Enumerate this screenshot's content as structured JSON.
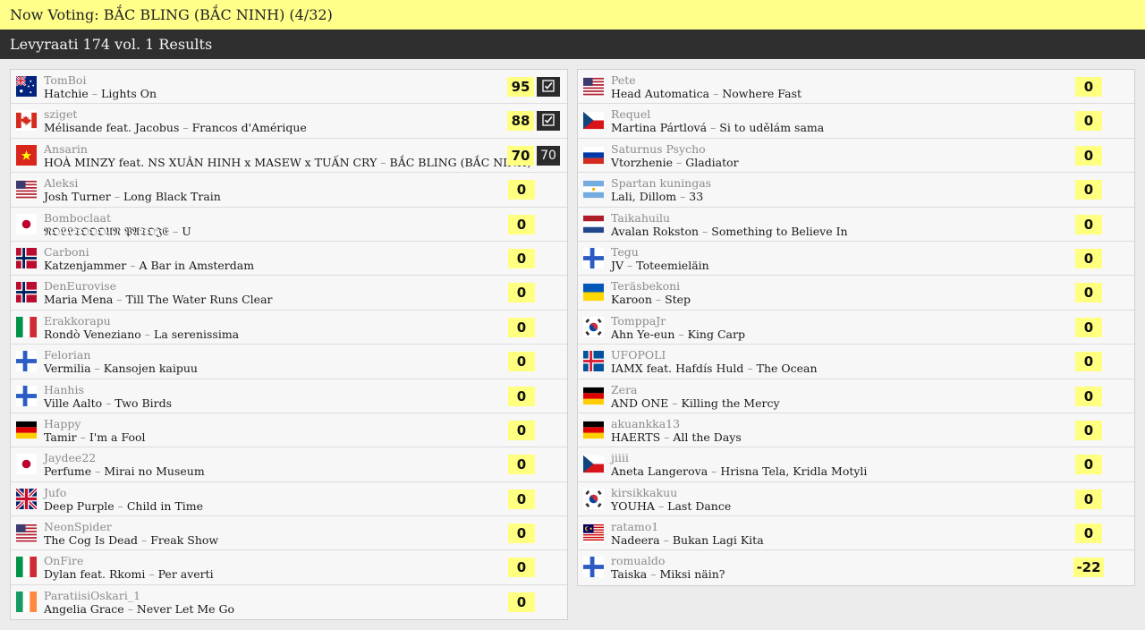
{
  "header": {
    "now_voting": "Now Voting: BẮC BLING (BẮC NINH) (4/32)",
    "results_title": "Levyraati 174 vol. 1 Results"
  },
  "colors": {
    "highlight": "#ffff8a",
    "score_bg": "#ffff80",
    "dark_bar": "#2f2f2f"
  },
  "left": [
    {
      "flag": "au",
      "user": "TomBoi",
      "artist": "Hatchie",
      "title": "Lights On",
      "score": "95",
      "mark": "check"
    },
    {
      "flag": "ca",
      "user": "sziget",
      "artist": "Mélisande feat. Jacobus",
      "title": "Francos d'Amérique",
      "score": "88",
      "mark": "check"
    },
    {
      "flag": "vn",
      "user": "Ansarin",
      "artist": "HOÀ MINZY feat. NS XUÂN HINH x MASEW x TUẤN CRY",
      "title": "BẮC BLING (BẮC NINH)",
      "score": "70",
      "mark": "70"
    },
    {
      "flag": "us",
      "user": "Aleksi",
      "artist": "Josh Turner",
      "title": "Long Black Train",
      "score": "0"
    },
    {
      "flag": "jp",
      "user": "Bomboclaat",
      "artist": "𝔑𝔒𝔏𝔏𝔗𝔒𝔒𝔒𝔘𝔑 𝔓𝔄𝔗𝔒𝔍𝔈",
      "title": "U",
      "score": "0"
    },
    {
      "flag": "no",
      "user": "Carboni",
      "artist": "Katzenjammer",
      "title": "A Bar in Amsterdam",
      "score": "0"
    },
    {
      "flag": "no",
      "user": "DenEurovise",
      "artist": "Maria Mena",
      "title": "Till The Water Runs Clear",
      "score": "0"
    },
    {
      "flag": "it",
      "user": "Erakkorapu",
      "artist": "Rondò Veneziano",
      "title": "La serenissima",
      "score": "0"
    },
    {
      "flag": "fi",
      "user": "Felorian",
      "artist": "Vermilia",
      "title": "Kansojen kaipuu",
      "score": "0"
    },
    {
      "flag": "fi",
      "user": "Hanhis",
      "artist": "Ville Aalto",
      "title": "Two Birds",
      "score": "0"
    },
    {
      "flag": "de",
      "user": "Happy",
      "artist": "Tamir",
      "title": "I'm a Fool",
      "score": "0"
    },
    {
      "flag": "jp",
      "user": "Jaydee22",
      "artist": "Perfume",
      "title": "Mirai no Museum",
      "score": "0"
    },
    {
      "flag": "gb",
      "user": "Jufo",
      "artist": "Deep Purple",
      "title": "Child in Time",
      "score": "0"
    },
    {
      "flag": "us",
      "user": "NeonSpider",
      "artist": "The Cog Is Dead",
      "title": "Freak Show",
      "score": "0"
    },
    {
      "flag": "it",
      "user": "OnFire",
      "artist": "Dylan feat. Rkomi",
      "title": "Per averti",
      "score": "0"
    },
    {
      "flag": "ie",
      "user": "ParatiisiOskari_1",
      "artist": "Angelia Grace",
      "title": "Never Let Me Go",
      "score": "0"
    }
  ],
  "right": [
    {
      "flag": "us",
      "user": "Pete",
      "artist": "Head Automatica",
      "title": "Nowhere Fast",
      "score": "0"
    },
    {
      "flag": "cz",
      "user": "Requel",
      "artist": "Martina Pártlová",
      "title": "Si to udělám sama",
      "score": "0"
    },
    {
      "flag": "ru",
      "user": "Saturnus Psycho",
      "artist": "Vtorzhenie",
      "title": "Gladiator",
      "score": "0"
    },
    {
      "flag": "ar",
      "user": "Spartan kuningas",
      "artist": "Lali, Dillom",
      "title": "33",
      "score": "0"
    },
    {
      "flag": "nl",
      "user": "Taikahuilu",
      "artist": "Avalan Rokston",
      "title": "Something to Believe In",
      "score": "0"
    },
    {
      "flag": "fi",
      "user": "Tegu",
      "artist": "JV",
      "title": "Toteemieläin",
      "score": "0"
    },
    {
      "flag": "ua",
      "user": "Teräsbekoni",
      "artist": "Karoon",
      "title": "Step",
      "score": "0"
    },
    {
      "flag": "kr",
      "user": "TomppaJr",
      "artist": "Ahn Ye-eun",
      "title": "King Carp",
      "score": "0"
    },
    {
      "flag": "is",
      "user": "UFOPOLI",
      "artist": "IAMX feat. Hafdís Huld",
      "title": "The Ocean",
      "score": "0"
    },
    {
      "flag": "de",
      "user": "Zera",
      "artist": "AND ONE",
      "title": "Killing the Mercy",
      "score": "0"
    },
    {
      "flag": "de",
      "user": "akuankka13",
      "artist": "HAERTS",
      "title": "All the Days",
      "score": "0"
    },
    {
      "flag": "cz",
      "user": "jiiii",
      "artist": "Aneta Langerova",
      "title": "Hrisna Tela, Kridla Motyli",
      "score": "0"
    },
    {
      "flag": "kr",
      "user": "kirsikkakuu",
      "artist": "YOUHA",
      "title": "Last Dance",
      "score": "0"
    },
    {
      "flag": "my",
      "user": "ratamo1",
      "artist": "Nadeera",
      "title": "Bukan Lagi Kita",
      "score": "0"
    },
    {
      "flag": "fi",
      "user": "romualdo",
      "artist": "Taiska",
      "title": "Miksi näin?",
      "score": "-22"
    }
  ]
}
